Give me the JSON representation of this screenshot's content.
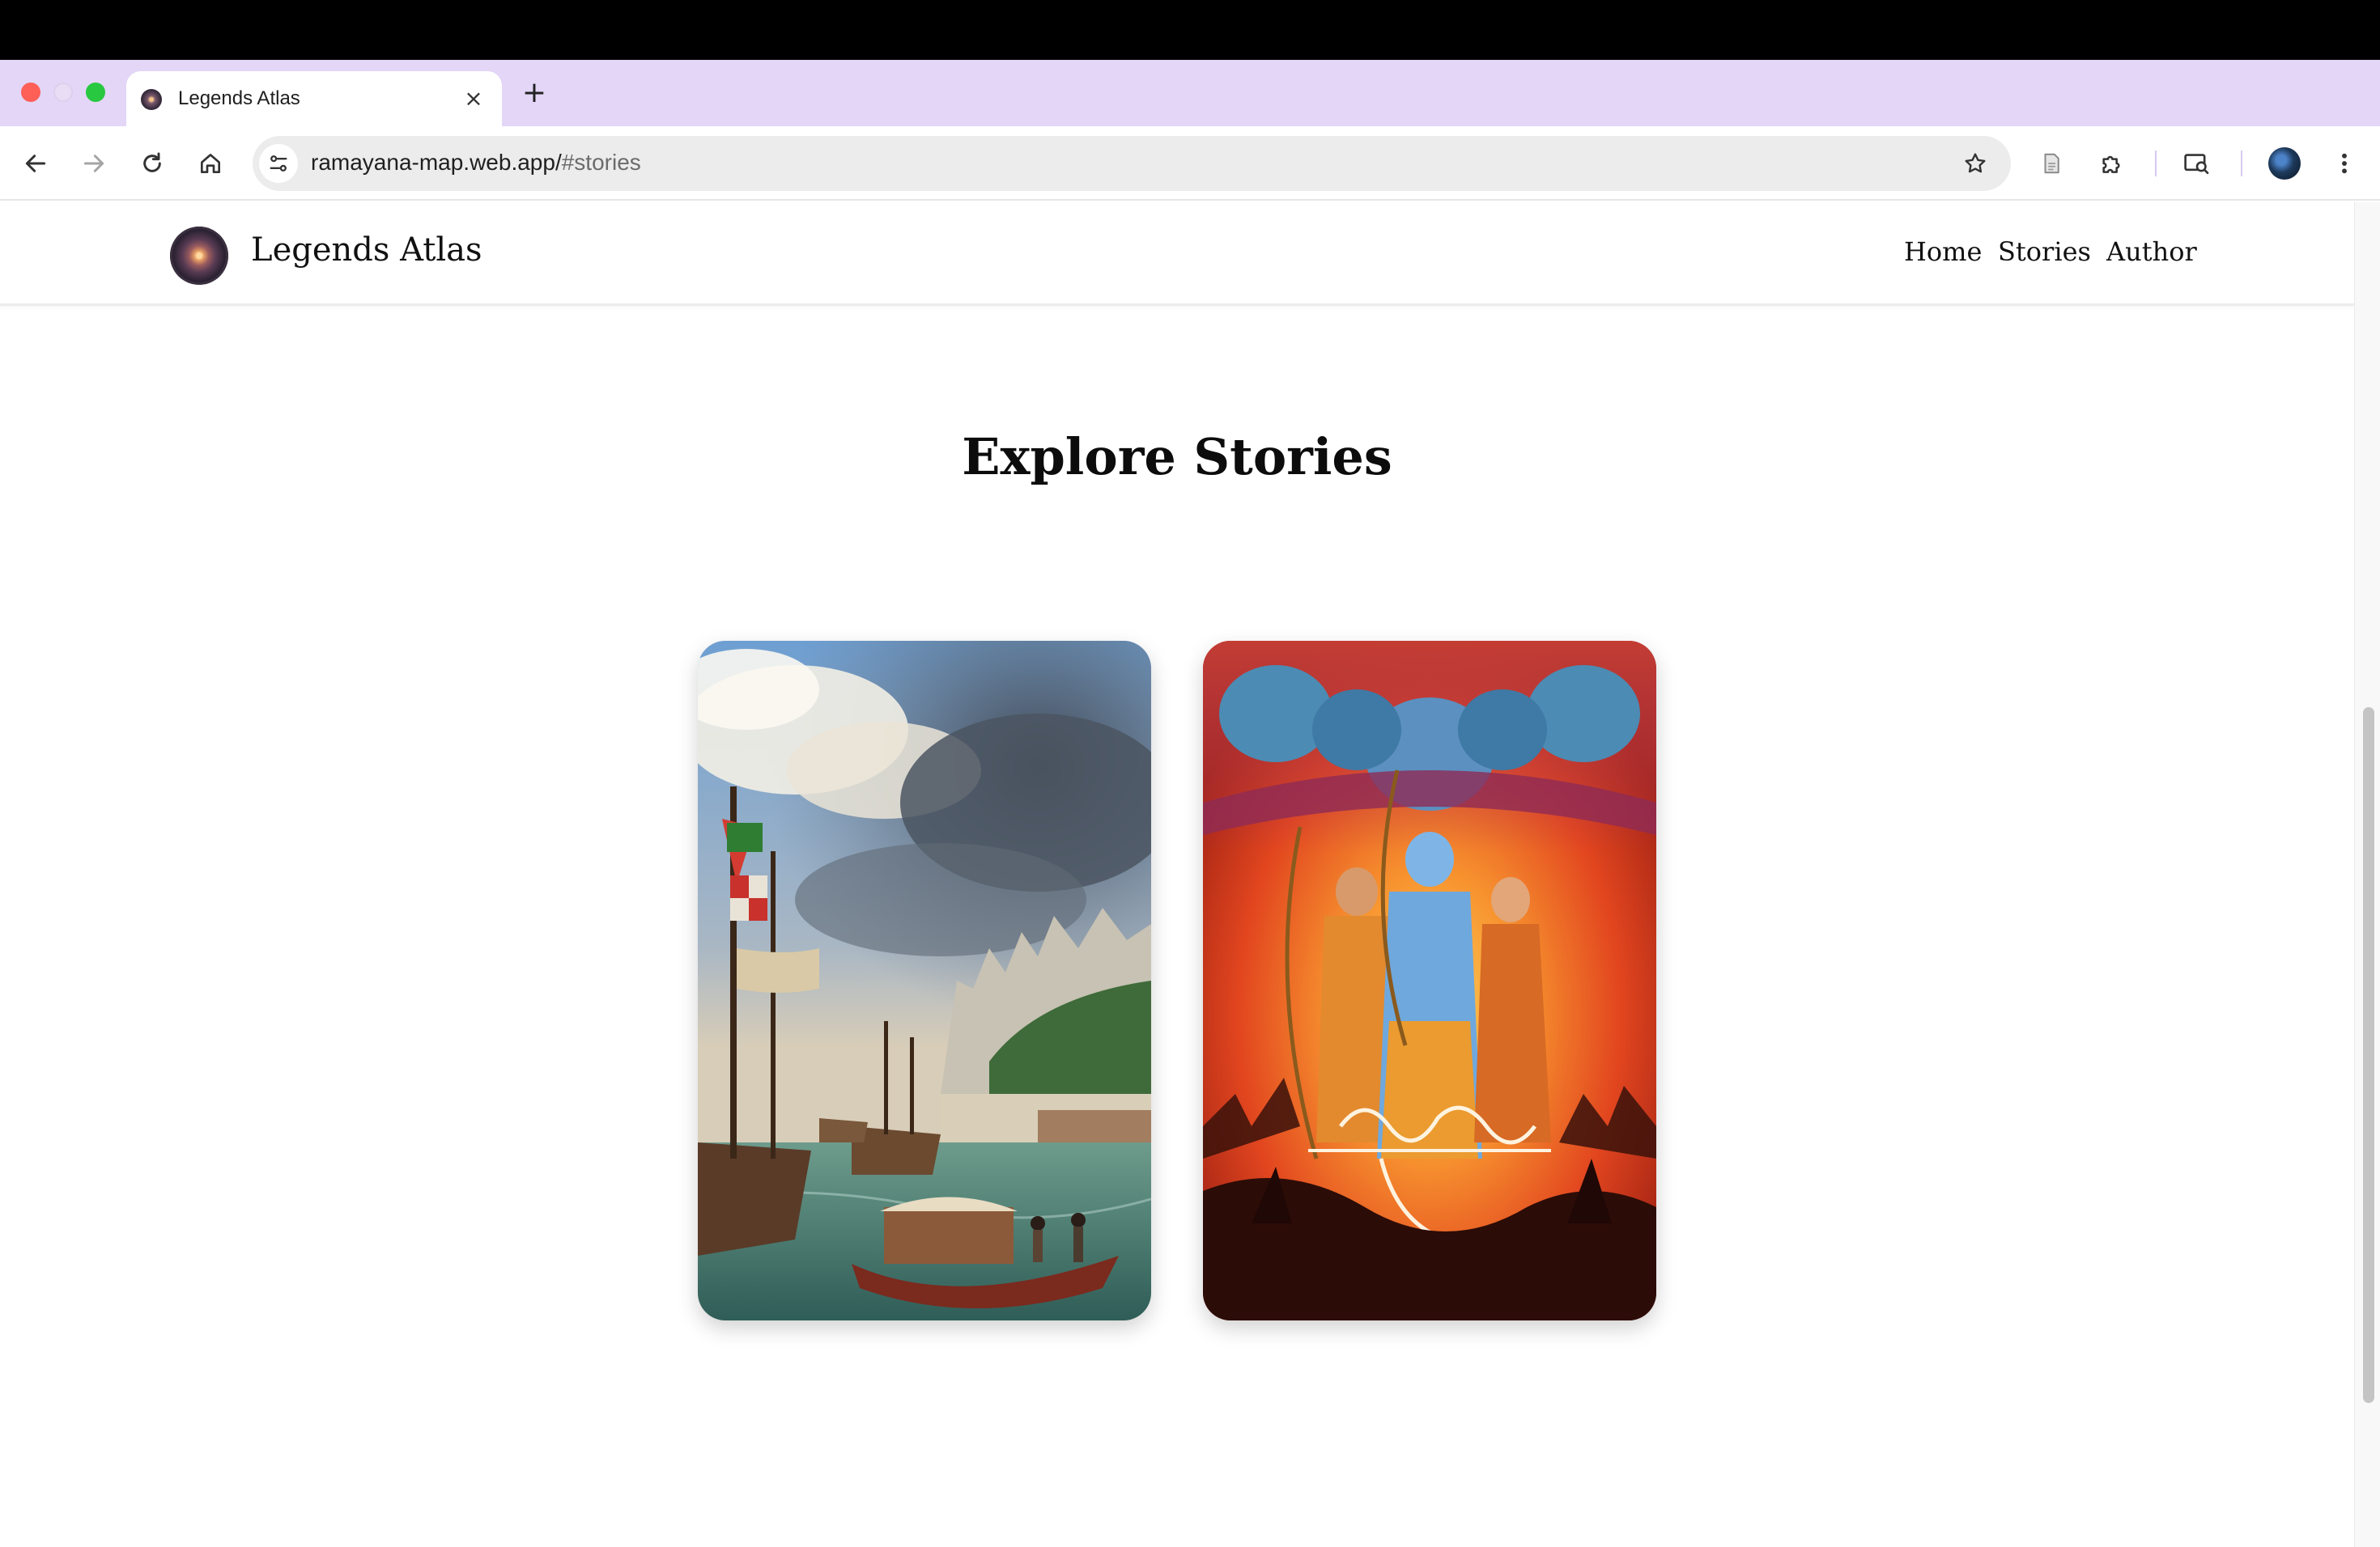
{
  "browser": {
    "tab": {
      "title": "Legends Atlas",
      "close_icon": "close-icon"
    },
    "new_tab_icon": "plus-icon",
    "address": {
      "host": "ramayana-map.web.app/",
      "path": "#stories"
    }
  },
  "site": {
    "title": "Legends Atlas",
    "nav": [
      "Home",
      "Stories",
      "Author"
    ]
  },
  "section": {
    "title": "Explore Stories"
  },
  "cards": [
    {
      "name": "story-card-voyage",
      "image_desc_icon": "harbor-ships-image"
    },
    {
      "name": "story-card-ramayana",
      "image_desc_icon": "rama-sita-lakshmana-image"
    }
  ],
  "colors": {
    "tabbar": "#e3d6f7",
    "omnibox": "#ececec",
    "accent_red": "#fe5f57",
    "accent_green": "#28c840"
  }
}
